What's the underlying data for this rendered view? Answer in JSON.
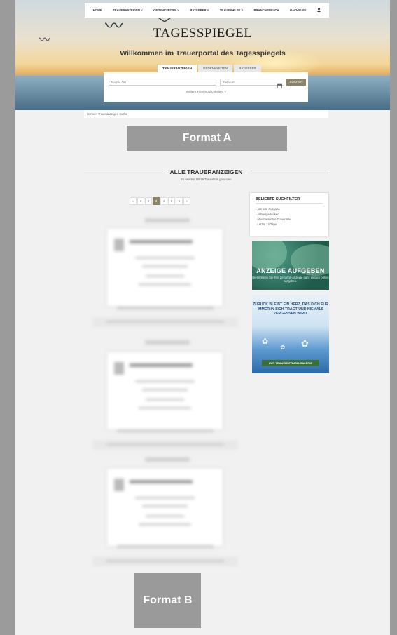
{
  "nav": {
    "items": [
      "HOME",
      "TRAUERANZEIGEN ˅",
      "GEDENKSEITEN ˅",
      "RATGEBER ˅",
      "TRAUERHILFE ˅",
      "BRANCHENBUCH",
      "NACHRUFE"
    ],
    "user_icon": "user-icon"
  },
  "header": {
    "logo": "TAGESSPIEGEL",
    "welcome": "Willkommen im Trauerportal des Tagesspiegels"
  },
  "search": {
    "tabs": [
      "TRAUERANZEIGEN",
      "GEDENKSEITEN",
      "RATGEBER"
    ],
    "name_placeholder": "Name, Ort",
    "period_placeholder": "Zeitraum",
    "calendar_icon": "calendar-icon",
    "button": "SUCHEN",
    "more_filters": "Weitere Filtermöglichkeiten ˅"
  },
  "breadcrumb": {
    "home": "Home",
    "sep": ">",
    "current": "Traueranzeigen Suche"
  },
  "placeholders": {
    "format_a": "Format A",
    "format_b": "Format B"
  },
  "results": {
    "title": "ALLE TRAUERANZEIGEN",
    "subtitle": "Es wurden 16979 Trauerfälle gefunden",
    "pagination": [
      "«",
      "1",
      "2",
      "3",
      "4",
      "5",
      "6",
      "»"
    ],
    "current_page": "3"
  },
  "sidebar": {
    "filter_title": "BELIEBTE SUCHFILTER",
    "filters": [
      "› Aktuelle Ausgabe",
      "› Jahresgedenken",
      "› Meistbesuchte Trauerfälle",
      "› Letzte 14 Tage"
    ],
    "promo1_title": "ANZEIGE AUFGEBEN",
    "promo1_text": "Hier können Sie Ihre Zeitungs-Anzeige ganz einfach online aufgeben.",
    "promo2_quote": "ZURÜCK BLEIBT EIN HERZ, DAS DICH FÜR IMMER IN SICH TRÄGT UND NIEMALS VERGESSEN WIRD.",
    "promo2_button": "ZUR TRAUERSPRUCH-GALERIE"
  },
  "colors": {
    "accent": "#8b8368",
    "placeholder_bg": "#9a9a9a"
  }
}
